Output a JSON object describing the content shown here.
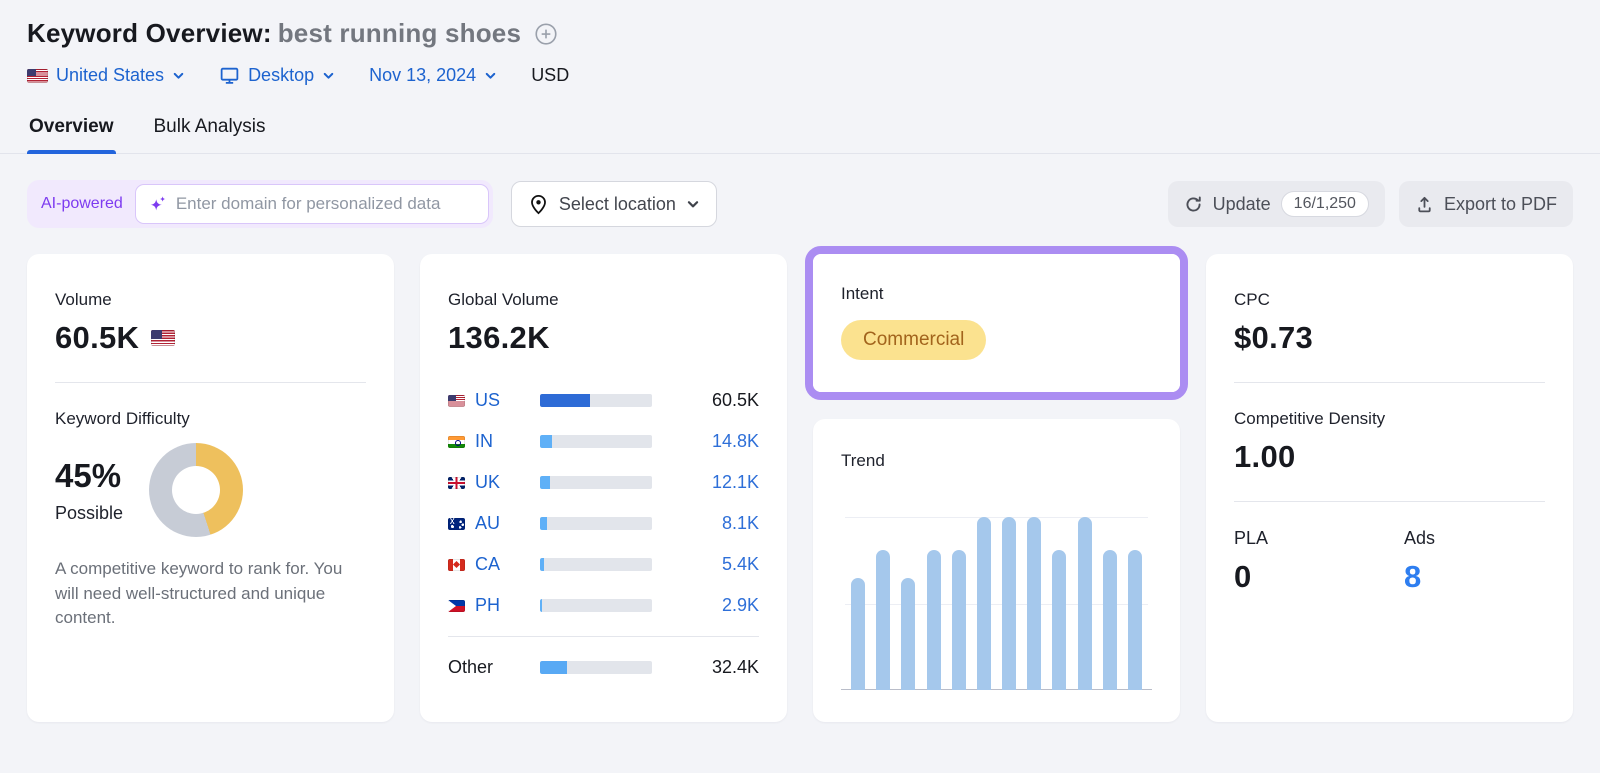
{
  "header": {
    "title_prefix": "Keyword Overview:",
    "keyword": "best running shoes",
    "filters": {
      "country": "United States",
      "device": "Desktop",
      "date": "Nov 13, 2024",
      "currency": "USD"
    }
  },
  "tabs": [
    {
      "label": "Overview",
      "active": true
    },
    {
      "label": "Bulk Analysis",
      "active": false
    }
  ],
  "toolbar": {
    "ai_badge": "AI-powered",
    "domain_input_value": "",
    "domain_input_placeholder": "Enter domain for personalized data",
    "location_button": "Select location",
    "update_button": "Update",
    "update_quota": "16/1,250",
    "export_button": "Export to PDF"
  },
  "cards": {
    "volume": {
      "label": "Volume",
      "value": "60.5K",
      "flag": "us"
    },
    "keyword_difficulty": {
      "label": "Keyword Difficulty",
      "value": "45%",
      "percent": 45,
      "qualifier": "Possible",
      "description": "A competitive keyword to rank for. You will need well-structured and unique content."
    },
    "global_volume": {
      "label": "Global Volume",
      "value": "136.2K",
      "rows": [
        {
          "code": "US",
          "flag": "us",
          "value": "60.5K",
          "pct": 44.4,
          "emphasis": true,
          "link": false
        },
        {
          "code": "IN",
          "flag": "in",
          "value": "14.8K",
          "pct": 10.9,
          "emphasis": false,
          "link": true
        },
        {
          "code": "UK",
          "flag": "uk",
          "value": "12.1K",
          "pct": 8.9,
          "emphasis": false,
          "link": true
        },
        {
          "code": "AU",
          "flag": "au",
          "value": "8.1K",
          "pct": 5.9,
          "emphasis": false,
          "link": true
        },
        {
          "code": "CA",
          "flag": "ca",
          "value": "5.4K",
          "pct": 4.0,
          "emphasis": false,
          "link": true
        },
        {
          "code": "PH",
          "flag": "ph",
          "value": "2.9K",
          "pct": 2.1,
          "emphasis": false,
          "link": true
        }
      ],
      "other": {
        "label": "Other",
        "value": "32.4K",
        "pct": 23.8
      }
    },
    "intent": {
      "label": "Intent",
      "badge": "Commercial"
    },
    "trend": {
      "label": "Trend",
      "bars_pct": [
        65,
        81,
        65,
        81,
        81,
        100,
        100,
        100,
        81,
        100,
        81,
        81
      ]
    },
    "cpc": {
      "label": "CPC",
      "value": "$0.73"
    },
    "competitive_density": {
      "label": "Competitive Density",
      "value": "1.00"
    },
    "pla": {
      "label": "PLA",
      "value": "0"
    },
    "ads": {
      "label": "Ads",
      "value": "8"
    }
  },
  "chart_data": [
    {
      "type": "bar",
      "orientation": "horizontal",
      "title": "Global Volume by country",
      "categories": [
        "US",
        "IN",
        "UK",
        "AU",
        "CA",
        "PH",
        "Other"
      ],
      "values": [
        60500,
        14800,
        12100,
        8100,
        5400,
        2900,
        32400
      ],
      "total": 136200,
      "xlabel": "",
      "ylabel": "",
      "xlim": [
        0,
        136200
      ],
      "grid": false
    },
    {
      "type": "bar",
      "title": "Trend",
      "categories": [
        "",
        "",
        "",
        "",
        "",
        "",
        "",
        "",
        "",
        "",
        "",
        ""
      ],
      "values": [
        0.65,
        0.81,
        0.65,
        0.81,
        0.81,
        1.0,
        1.0,
        1.0,
        0.81,
        1.0,
        0.81,
        0.81
      ],
      "xlabel": "",
      "ylabel": "",
      "ylim": [
        0,
        1
      ],
      "grid": true,
      "note": "12 monthly bars, relative search volume"
    },
    {
      "type": "pie",
      "title": "Keyword Difficulty donut",
      "categories": [
        "difficulty",
        "remainder"
      ],
      "values": [
        45,
        55
      ]
    }
  ],
  "colors": {
    "accent_blue": "#1d63cf",
    "tab_underline": "#2264dc",
    "us_bar_fill": "#2e6bd6",
    "country_bar_fill": "#5fb0f7",
    "other_bar_fill": "#58a9f4",
    "trend_bar": "#a5c8ec",
    "donut_yellow": "#eec05d",
    "donut_gray": "#c7ccd6",
    "highlight_purple": "#ab8df2",
    "intent_badge_bg": "#fbe28f",
    "intent_badge_text": "#a2641c",
    "ads_blue": "#2e7ef0"
  }
}
